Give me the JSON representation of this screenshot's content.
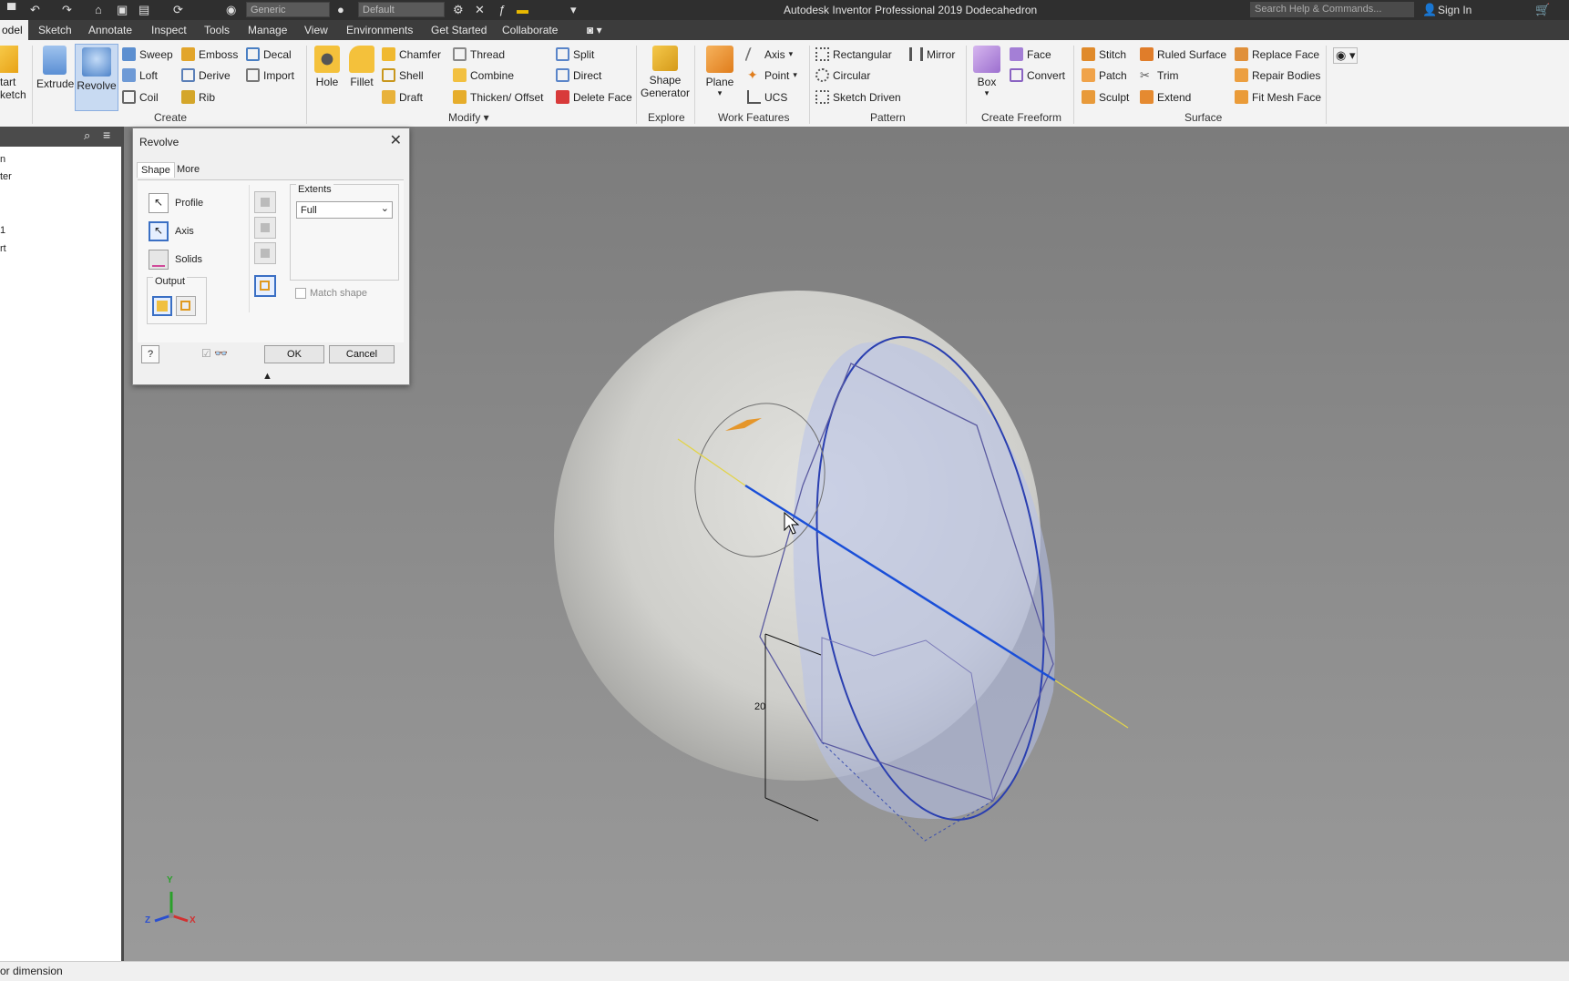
{
  "titlebar": {
    "app_title": "Autodesk Inventor Professional 2019    Dodecahedron",
    "material_combo": "Generic",
    "appearance_combo": "Default",
    "search_placeholder": "Search Help & Commands...",
    "signin_label": "Sign In"
  },
  "tabs": [
    "odel",
    "Sketch",
    "Annotate",
    "Inspect",
    "Tools",
    "Manage",
    "View",
    "Environments",
    "Get Started",
    "Collaborate"
  ],
  "ribbon": {
    "sketch_partial": [
      "tart",
      "ketch"
    ],
    "create": {
      "extrude": "Extrude",
      "revolve": "Revolve",
      "sweep": "Sweep",
      "loft": "Loft",
      "coil": "Coil",
      "emboss": "Emboss",
      "derive": "Derive",
      "rib": "Rib",
      "decal": "Decal",
      "import": "Import",
      "label": "Create"
    },
    "modify": {
      "hole": "Hole",
      "fillet": "Fillet",
      "chamfer": "Chamfer",
      "shell": "Shell",
      "draft": "Draft",
      "thread": "Thread",
      "combine": "Combine",
      "thicken": "Thicken/ Offset",
      "split": "Split",
      "direct": "Direct",
      "delete_face": "Delete Face",
      "label": "Modify"
    },
    "explore": {
      "shape_generator": [
        "Shape",
        "Generator"
      ],
      "label": "Explore"
    },
    "work_features": {
      "plane": "Plane",
      "axis": "Axis",
      "point": "Point",
      "ucs": "UCS",
      "label": "Work Features"
    },
    "pattern": {
      "rectangular": "Rectangular",
      "circular": "Circular",
      "sketch_driven": "Sketch Driven",
      "mirror": "Mirror",
      "label": "Pattern"
    },
    "freeform": {
      "box": "Box",
      "face": "Face",
      "convert": "Convert",
      "label": "Create Freeform"
    },
    "surface": {
      "stitch": "Stitch",
      "patch": "Patch",
      "sculpt": "Sculpt",
      "ruled_surface": "Ruled Surface",
      "trim": "Trim",
      "extend": "Extend",
      "replace_face": "Replace Face",
      "repair_bodies": "Repair Bodies",
      "fit_mesh_face": "Fit Mesh Face",
      "label": "Surface"
    }
  },
  "browser": {
    "items": [
      "n",
      "ter",
      "1",
      "rt"
    ]
  },
  "dialog": {
    "title": "Revolve",
    "tabs": [
      "Shape",
      "More"
    ],
    "profile": "Profile",
    "axis": "Axis",
    "solids": "Solids",
    "output_label": "Output",
    "extents_label": "Extents",
    "extents_value": "Full",
    "match_shape": "Match shape",
    "ok": "OK",
    "cancel": "Cancel"
  },
  "viewport": {
    "dimension_value": "20"
  },
  "triad": {
    "x": "X",
    "y": "Y",
    "z": "Z"
  },
  "status": {
    "text": "or dimension"
  },
  "colors": {
    "accent": "#3a6fc4",
    "profile_fill": "#b9c3ec",
    "axis_line": "#1a4fd8",
    "sphere": "#d2d2ce"
  }
}
